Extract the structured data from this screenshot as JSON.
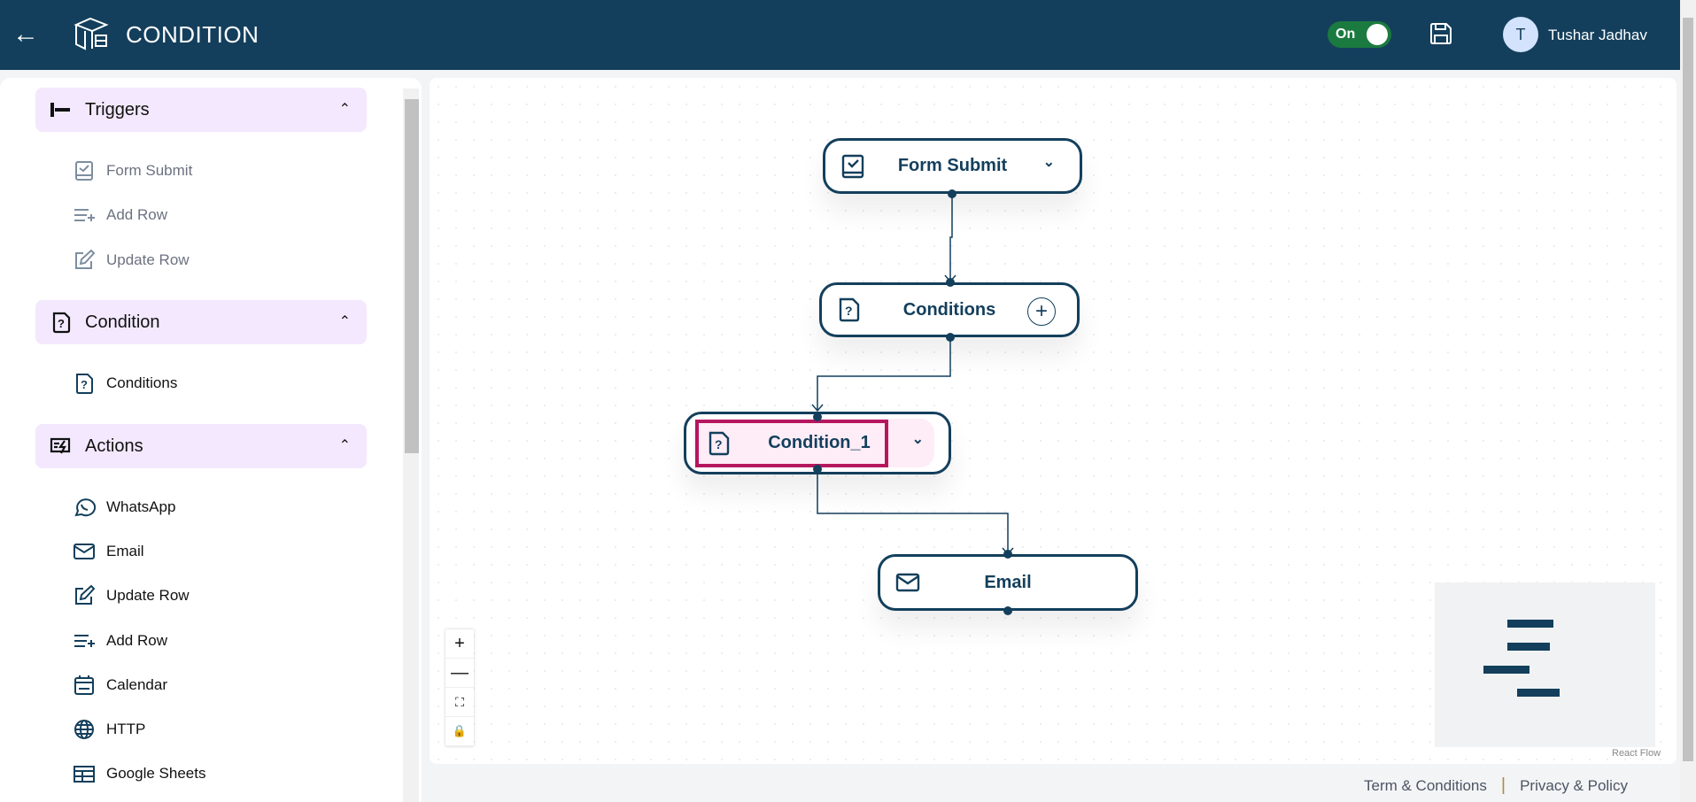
{
  "header": {
    "title": "CONDITION",
    "toggle_label": "On",
    "toggle_on": true,
    "user_initial": "T",
    "user_name": "Tushar Jadhav",
    "colors": {
      "bg": "#133f5c",
      "toggle": "#1b7a3f",
      "avatar": "#d3e3fd"
    }
  },
  "sidebar": {
    "sections": [
      {
        "label": "Triggers",
        "icon": "trigger-icon",
        "items": [
          {
            "label": "Form Submit",
            "icon": "form-check-icon"
          },
          {
            "label": "Add Row",
            "icon": "add-row-icon"
          },
          {
            "label": "Update Row",
            "icon": "edit-icon"
          }
        ]
      },
      {
        "label": "Condition",
        "icon": "question-file-icon",
        "items": [
          {
            "label": "Conditions",
            "icon": "question-file-icon"
          }
        ]
      },
      {
        "label": "Actions",
        "icon": "actions-icon",
        "items": [
          {
            "label": "WhatsApp",
            "icon": "whatsapp-icon"
          },
          {
            "label": "Email",
            "icon": "mail-icon"
          },
          {
            "label": "Update Row",
            "icon": "edit-icon"
          },
          {
            "label": "Add Row",
            "icon": "add-row-icon"
          },
          {
            "label": "Calendar",
            "icon": "calendar-icon"
          },
          {
            "label": "HTTP",
            "icon": "globe-icon"
          },
          {
            "label": "Google Sheets",
            "icon": "sheet-icon"
          }
        ]
      }
    ]
  },
  "flow": {
    "nodes": [
      {
        "label": "Form Submit"
      },
      {
        "label": "Conditions"
      },
      {
        "label": "Condition_1",
        "selected": true
      },
      {
        "label": "Email"
      }
    ],
    "attribution": "React Flow",
    "highlight_color": "#b5175f"
  },
  "footer": {
    "terms": "Term & Conditions",
    "separator": "|",
    "privacy": "Privacy & Policy"
  }
}
